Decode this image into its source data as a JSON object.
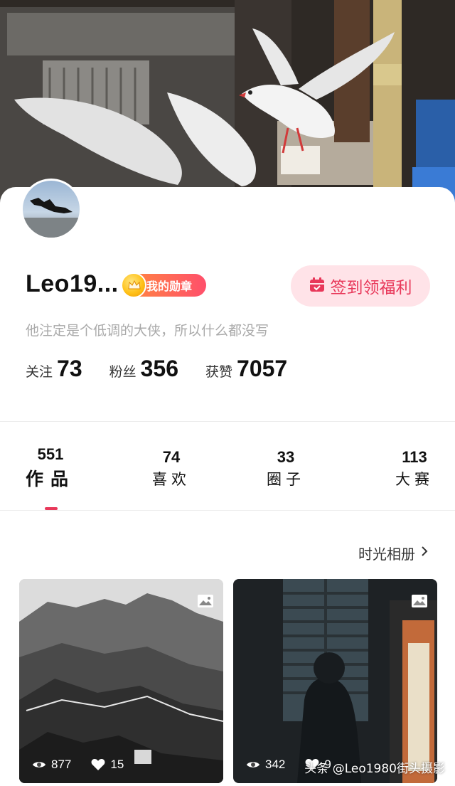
{
  "profile": {
    "nickname": "Leo19...",
    "badge_label": "我的勋章",
    "signin_label": "签到领福利",
    "bio": "他注定是个低调的大侠，所以什么都没写"
  },
  "stats": [
    {
      "label": "关注",
      "value": "73"
    },
    {
      "label": "粉丝",
      "value": "356"
    },
    {
      "label": "获赞",
      "value": "7057"
    }
  ],
  "tabs": [
    {
      "count": "551",
      "label": "作品",
      "active": true
    },
    {
      "count": "74",
      "label": "喜欢"
    },
    {
      "count": "33",
      "label": "圈子"
    },
    {
      "count": "113",
      "label": "大赛"
    }
  ],
  "album_link": "时光相册",
  "posts": [
    {
      "views": "877",
      "likes": "15"
    },
    {
      "views": "342",
      "likes": "9"
    }
  ],
  "watermark": "头条 @Leo1980街头摄影",
  "colors": {
    "accent": "#e8385a",
    "badge_start": "#ff8a3d",
    "badge_end": "#ff4f6b",
    "signin_bg": "#ffe3e8"
  }
}
